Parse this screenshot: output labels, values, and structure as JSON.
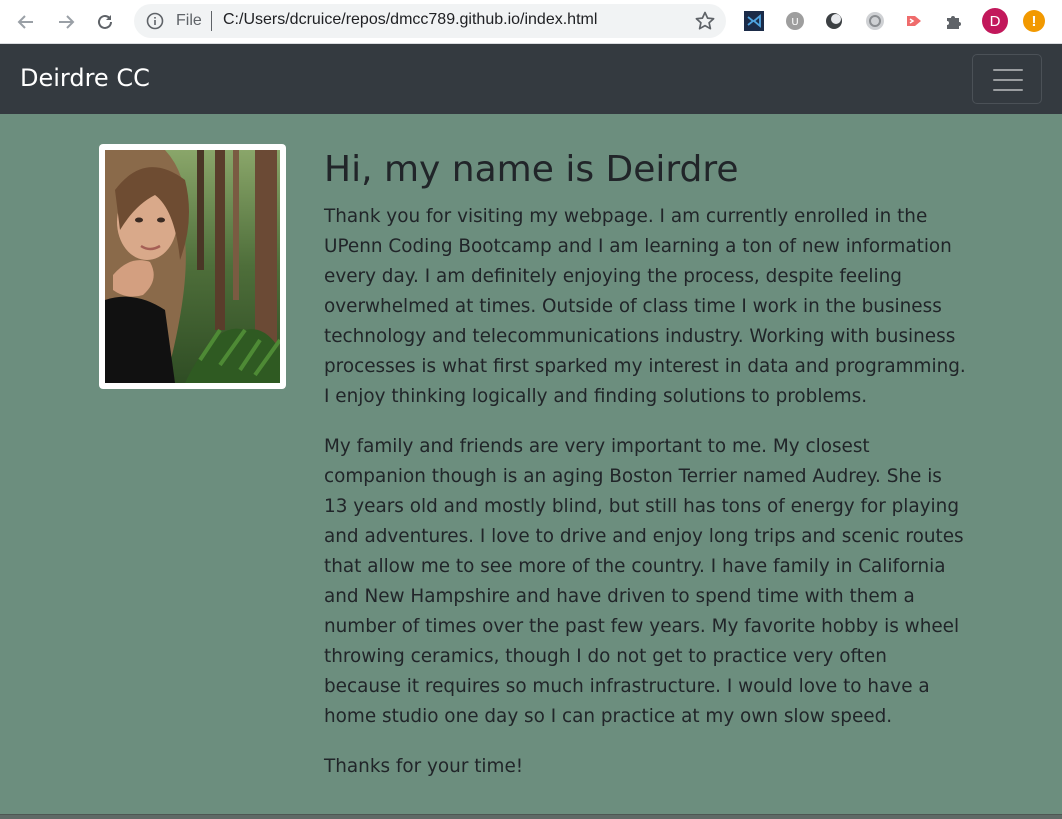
{
  "browser": {
    "file_label": "File",
    "url": "C:/Users/dcruice/repos/dmcc789.github.io/index.html",
    "profile_initial": "D",
    "alert_symbol": "!",
    "extension_icons": [
      "visual-studio-icon",
      "ublock-icon",
      "circle-extension-icon",
      "grey-circle-extension-icon",
      "arrow-extension-icon",
      "puzzle-icon"
    ]
  },
  "navbar": {
    "brand": "Deirdre CC",
    "toggler_icon": "hamburger-icon"
  },
  "main": {
    "heading": "Hi, my name is Deirdre",
    "paragraphs": [
      "Thank you for visiting my webpage. I am currently enrolled in the UPenn Coding Bootcamp and I am learning a ton of new information every day. I am definitely enjoying the process, despite feeling overwhelmed at times. Outside of class time I work in the business technology and telecommunications industry. Working with business processes is what first sparked my interest in data and programming. I enjoy thinking logically and finding solutions to problems.",
      "My family and friends are very important to me. My closest companion though is an aging Boston Terrier named Audrey. She is 13 years old and mostly blind, but still has tons of energy for playing and adventures. I love to drive and enjoy long trips and scenic routes that allow me to see more of the country. I have family in California and New Hampshire and have driven to spend time with them a number of times over the past few years. My favorite hobby is wheel throwing ceramics, though I do not get to practice very often because it requires so much infrastructure. I would love to have a home studio one day so I can practice at my own slow speed.",
      "Thanks for your time!"
    ]
  },
  "colors": {
    "page_bg": "#6c8e7e",
    "navbar_bg": "#343a40",
    "text": "#212529",
    "profile": "#c2185b",
    "alert": "#f29900"
  }
}
